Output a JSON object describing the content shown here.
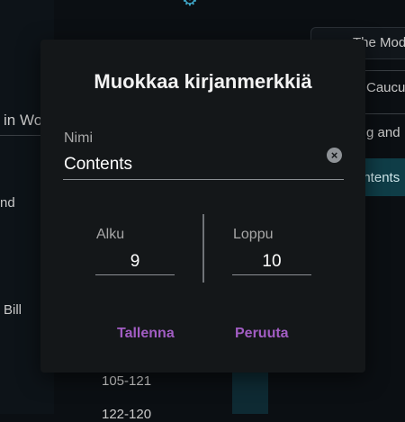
{
  "background": {
    "left_text_in": "in Wo",
    "left_text_and": "nd",
    "left_text_bill": "Bill",
    "right_item_1": "The Mod",
    "right_item_2": "Caucu",
    "right_item_3": "g and",
    "right_item_4": "ontents",
    "page_range_1": "105-121",
    "page_range_2": "122-120"
  },
  "dialog": {
    "title": "Muokkaa kirjanmerkkiä",
    "name_label": "Nimi",
    "name_value": "Contents",
    "start_label": "Alku",
    "start_value": "9",
    "end_label": "Loppu",
    "end_value": "10",
    "save_label": "Tallenna",
    "cancel_label": "Peruuta"
  },
  "colors": {
    "accent": "#a25dc3",
    "dialog_bg": "#141719",
    "page_bg": "#0b0f13"
  },
  "icons": {
    "clear": "close-circle-icon",
    "background_gear": "gear-icon"
  }
}
